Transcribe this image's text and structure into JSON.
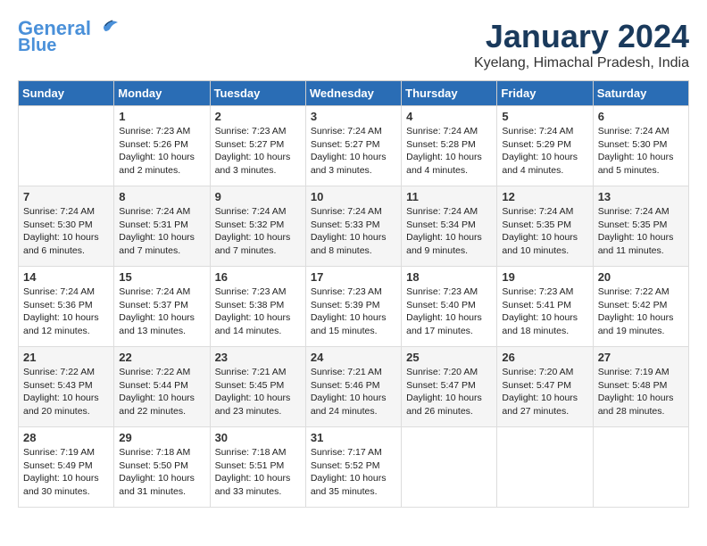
{
  "header": {
    "logo_line1": "General",
    "logo_line2": "Blue",
    "month_title": "January 2024",
    "location": "Kyelang, Himachal Pradesh, India"
  },
  "days_of_week": [
    "Sunday",
    "Monday",
    "Tuesday",
    "Wednesday",
    "Thursday",
    "Friday",
    "Saturday"
  ],
  "weeks": [
    [
      {
        "day": "",
        "info": ""
      },
      {
        "day": "1",
        "info": "Sunrise: 7:23 AM\nSunset: 5:26 PM\nDaylight: 10 hours\nand 2 minutes."
      },
      {
        "day": "2",
        "info": "Sunrise: 7:23 AM\nSunset: 5:27 PM\nDaylight: 10 hours\nand 3 minutes."
      },
      {
        "day": "3",
        "info": "Sunrise: 7:24 AM\nSunset: 5:27 PM\nDaylight: 10 hours\nand 3 minutes."
      },
      {
        "day": "4",
        "info": "Sunrise: 7:24 AM\nSunset: 5:28 PM\nDaylight: 10 hours\nand 4 minutes."
      },
      {
        "day": "5",
        "info": "Sunrise: 7:24 AM\nSunset: 5:29 PM\nDaylight: 10 hours\nand 4 minutes."
      },
      {
        "day": "6",
        "info": "Sunrise: 7:24 AM\nSunset: 5:30 PM\nDaylight: 10 hours\nand 5 minutes."
      }
    ],
    [
      {
        "day": "7",
        "info": "Sunrise: 7:24 AM\nSunset: 5:30 PM\nDaylight: 10 hours\nand 6 minutes."
      },
      {
        "day": "8",
        "info": "Sunrise: 7:24 AM\nSunset: 5:31 PM\nDaylight: 10 hours\nand 7 minutes."
      },
      {
        "day": "9",
        "info": "Sunrise: 7:24 AM\nSunset: 5:32 PM\nDaylight: 10 hours\nand 7 minutes."
      },
      {
        "day": "10",
        "info": "Sunrise: 7:24 AM\nSunset: 5:33 PM\nDaylight: 10 hours\nand 8 minutes."
      },
      {
        "day": "11",
        "info": "Sunrise: 7:24 AM\nSunset: 5:34 PM\nDaylight: 10 hours\nand 9 minutes."
      },
      {
        "day": "12",
        "info": "Sunrise: 7:24 AM\nSunset: 5:35 PM\nDaylight: 10 hours\nand 10 minutes."
      },
      {
        "day": "13",
        "info": "Sunrise: 7:24 AM\nSunset: 5:35 PM\nDaylight: 10 hours\nand 11 minutes."
      }
    ],
    [
      {
        "day": "14",
        "info": "Sunrise: 7:24 AM\nSunset: 5:36 PM\nDaylight: 10 hours\nand 12 minutes."
      },
      {
        "day": "15",
        "info": "Sunrise: 7:24 AM\nSunset: 5:37 PM\nDaylight: 10 hours\nand 13 minutes."
      },
      {
        "day": "16",
        "info": "Sunrise: 7:23 AM\nSunset: 5:38 PM\nDaylight: 10 hours\nand 14 minutes."
      },
      {
        "day": "17",
        "info": "Sunrise: 7:23 AM\nSunset: 5:39 PM\nDaylight: 10 hours\nand 15 minutes."
      },
      {
        "day": "18",
        "info": "Sunrise: 7:23 AM\nSunset: 5:40 PM\nDaylight: 10 hours\nand 17 minutes."
      },
      {
        "day": "19",
        "info": "Sunrise: 7:23 AM\nSunset: 5:41 PM\nDaylight: 10 hours\nand 18 minutes."
      },
      {
        "day": "20",
        "info": "Sunrise: 7:22 AM\nSunset: 5:42 PM\nDaylight: 10 hours\nand 19 minutes."
      }
    ],
    [
      {
        "day": "21",
        "info": "Sunrise: 7:22 AM\nSunset: 5:43 PM\nDaylight: 10 hours\nand 20 minutes."
      },
      {
        "day": "22",
        "info": "Sunrise: 7:22 AM\nSunset: 5:44 PM\nDaylight: 10 hours\nand 22 minutes."
      },
      {
        "day": "23",
        "info": "Sunrise: 7:21 AM\nSunset: 5:45 PM\nDaylight: 10 hours\nand 23 minutes."
      },
      {
        "day": "24",
        "info": "Sunrise: 7:21 AM\nSunset: 5:46 PM\nDaylight: 10 hours\nand 24 minutes."
      },
      {
        "day": "25",
        "info": "Sunrise: 7:20 AM\nSunset: 5:47 PM\nDaylight: 10 hours\nand 26 minutes."
      },
      {
        "day": "26",
        "info": "Sunrise: 7:20 AM\nSunset: 5:47 PM\nDaylight: 10 hours\nand 27 minutes."
      },
      {
        "day": "27",
        "info": "Sunrise: 7:19 AM\nSunset: 5:48 PM\nDaylight: 10 hours\nand 28 minutes."
      }
    ],
    [
      {
        "day": "28",
        "info": "Sunrise: 7:19 AM\nSunset: 5:49 PM\nDaylight: 10 hours\nand 30 minutes."
      },
      {
        "day": "29",
        "info": "Sunrise: 7:18 AM\nSunset: 5:50 PM\nDaylight: 10 hours\nand 31 minutes."
      },
      {
        "day": "30",
        "info": "Sunrise: 7:18 AM\nSunset: 5:51 PM\nDaylight: 10 hours\nand 33 minutes."
      },
      {
        "day": "31",
        "info": "Sunrise: 7:17 AM\nSunset: 5:52 PM\nDaylight: 10 hours\nand 35 minutes."
      },
      {
        "day": "",
        "info": ""
      },
      {
        "day": "",
        "info": ""
      },
      {
        "day": "",
        "info": ""
      }
    ]
  ]
}
